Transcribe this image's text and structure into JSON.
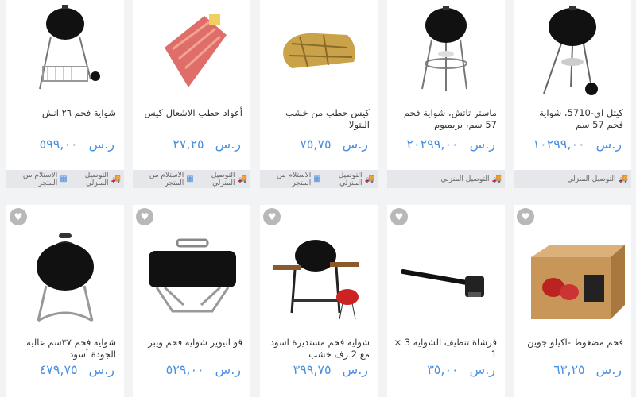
{
  "currency": "ر.س",
  "row1": [
    {
      "title": "كيتل اي-5710، شواية فحم 57 سم",
      "price": "١٠٢٩٩,٠٠",
      "delivery": "التوصيل المنزلي",
      "pickup": ""
    },
    {
      "title": "ماستر تاتش، شواية فحم 57 سم، بريميوم",
      "price": "٢٠٢٩٩,٠٠",
      "delivery": "التوصيل المنزلي",
      "pickup": ""
    },
    {
      "title": "كيس حطب من خشب البتولا",
      "price": "٧٥,٧٥",
      "delivery": "التوصيل المنزلي",
      "pickup": "الاستلام من المتجر"
    },
    {
      "title": "أعواد حطب الاشعال كيس",
      "price": "٢٧,٢٥",
      "delivery": "التوصيل المنزلي",
      "pickup": "الاستلام من المتجر"
    },
    {
      "title": "شواية فحم ٢٦ انش",
      "price": "٥٩٩,٠٠",
      "delivery": "التوصيل المنزلي",
      "pickup": "الاستلام من المتجر"
    }
  ],
  "row2": [
    {
      "title": "فحم مضغوط -اكيلو جوين",
      "price": "٦٣,٢٥"
    },
    {
      "title": "فرشاة تنظيف الشواية 3 × 1",
      "price": "٣٥,٠٠"
    },
    {
      "title": "شواية فحم مستديرة اسود مع 2 رف خشب",
      "price": "٣٩٩,٧٥"
    },
    {
      "title": "قو انيوير شواية فحم ويبر",
      "price": "٥٢٩,٠٠"
    },
    {
      "title": "شواية فحم ٣٧سم عالية الجودة أسود",
      "price": "٤٧٩,٧٥"
    }
  ],
  "icons": {
    "heart": "heart-icon",
    "truck": "truck-icon",
    "store": "store-icon"
  },
  "colors": {
    "price": "#4a90e2",
    "background": "#f2f3f5",
    "bar": "#e6e7ea"
  }
}
